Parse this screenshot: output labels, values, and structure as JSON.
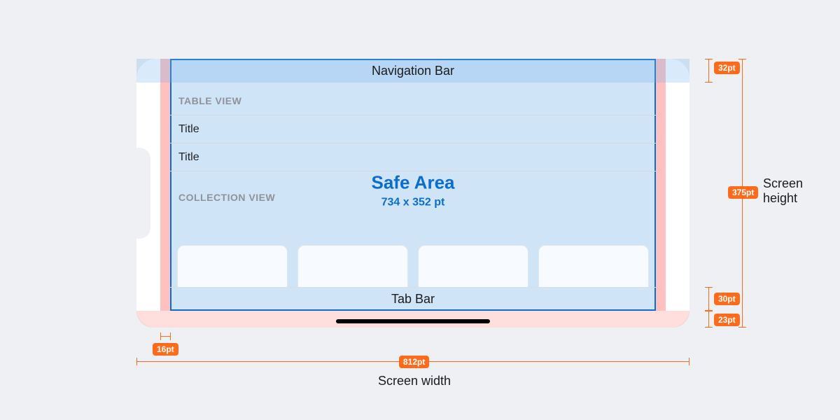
{
  "sections": {
    "nav_bar": "Navigation Bar",
    "table_view_header": "TABLE VIEW",
    "row_title": "Title",
    "collection_view_header": "COLLECTION VIEW",
    "tab_bar": "Tab Bar"
  },
  "safe_area": {
    "title": "Safe Area",
    "size_label": "734 x 352 pt",
    "width_pt": 734,
    "height_pt": 352
  },
  "measurements": {
    "nav_bar_height": "32pt",
    "screen_height": "375pt",
    "tab_bar_height": "30pt",
    "home_indicator_height": "23pt",
    "side_margin": "16pt",
    "screen_width": "812pt"
  },
  "axis_labels": {
    "screen_width": "Screen width",
    "screen_height": "Screen height"
  }
}
